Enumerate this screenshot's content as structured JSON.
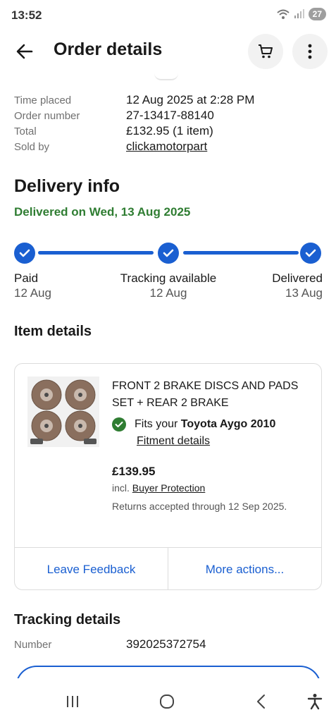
{
  "status_bar": {
    "time": "13:52",
    "battery": "27"
  },
  "header": {
    "title": "Order details"
  },
  "order": {
    "rows": [
      {
        "label": "Time placed",
        "value": "12 Aug 2025 at 2:28 PM"
      },
      {
        "label": "Order number",
        "value": "27-13417-88140"
      },
      {
        "label": "Total",
        "value": "£132.95 (1 item)"
      },
      {
        "label": "Sold by",
        "value": "clickamotorpart"
      }
    ]
  },
  "delivery": {
    "title": "Delivery info",
    "status": "Delivered on Wed, 13 Aug 2025",
    "steps": [
      {
        "label": "Paid",
        "date": "12 Aug"
      },
      {
        "label": "Tracking available",
        "date": "12 Aug"
      },
      {
        "label": "Delivered",
        "date": "13 Aug"
      }
    ]
  },
  "item": {
    "section_title": "Item details",
    "name": "FRONT 2 BRAKE DISCS AND PADS SET + REAR 2 BRAKE",
    "fits_prefix": "Fits your ",
    "fits_vehicle": "Toyota Aygo 2010",
    "fitment_link": "Fitment details",
    "price": "£139.95",
    "incl_prefix": "incl. ",
    "buyer_protection": "Buyer Protection",
    "returns": " Returns accepted through 12 Sep 2025.",
    "leave_feedback": "Leave Feedback",
    "more_actions": "More actions..."
  },
  "tracking": {
    "title": "Tracking details",
    "number_label": "Number",
    "number_value": "392025372754"
  },
  "icons": {
    "back": "arrow-left-icon",
    "cart": "cart-icon",
    "more": "more-vertical-icon",
    "check": "check-icon"
  },
  "colors": {
    "accent_blue": "#1a5fd1",
    "success_green": "#2f7d32",
    "text": "#191919",
    "muted": "#707070"
  }
}
